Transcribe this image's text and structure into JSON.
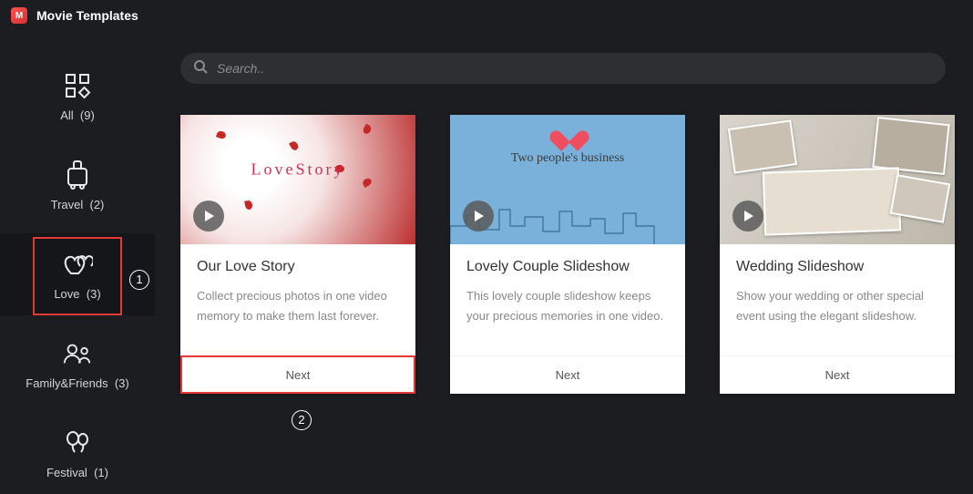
{
  "app": {
    "title": "Movie Templates",
    "logo_glyph": "M"
  },
  "search": {
    "placeholder": "Search.."
  },
  "sidebar": {
    "items": [
      {
        "icon": "grid",
        "label": "All",
        "count": "(9)"
      },
      {
        "icon": "suitcase",
        "label": "Travel",
        "count": "(2)"
      },
      {
        "icon": "hearts",
        "label": "Love",
        "count": "(3)",
        "selected": true
      },
      {
        "icon": "people",
        "label": "Family&Friends",
        "count": "(3)"
      },
      {
        "icon": "balloons",
        "label": "Festival",
        "count": "(1)"
      }
    ]
  },
  "templates": [
    {
      "id": "our-love-story",
      "title": "Our Love Story",
      "description": "Collect precious photos in one video memory to make them last forever.",
      "next_label": "Next",
      "highlighted": true,
      "thumb_style": "love"
    },
    {
      "id": "lovely-couple-slideshow",
      "title": "Lovely Couple Slideshow",
      "description": "This lovely couple slideshow keeps your precious memories in one video.",
      "next_label": "Next",
      "highlighted": false,
      "thumb_style": "couple"
    },
    {
      "id": "wedding-slideshow",
      "title": "Wedding Slideshow",
      "description": "Show your wedding or other special event using the elegant slideshow.",
      "next_label": "Next",
      "highlighted": false,
      "thumb_style": "wedding"
    }
  ],
  "annotations": {
    "step1": "1",
    "step2": "2"
  }
}
